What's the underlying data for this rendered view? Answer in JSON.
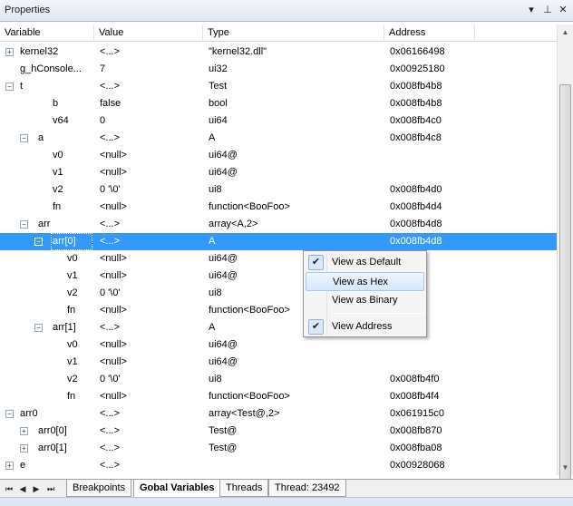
{
  "panel": {
    "title": "Properties",
    "buttons": {
      "dropdown": "▾",
      "pin": "⊥",
      "close": "✕"
    }
  },
  "columns": [
    "Variable",
    "Value",
    "Type",
    "Address"
  ],
  "rows": [
    {
      "name": "kernel32",
      "value": "<...>",
      "type": "\"kernel32.dll\"",
      "address": "0x06166498",
      "level": 0,
      "expander": "+"
    },
    {
      "name": "g_hConsole...",
      "value": "7",
      "type": "ui32",
      "address": "0x00925180",
      "level": 0,
      "expander": ""
    },
    {
      "name": "t",
      "value": "<...>",
      "type": "Test",
      "address": "0x008fb4b8",
      "level": 0,
      "expander": "−"
    },
    {
      "name": "b",
      "value": "false",
      "type": "bool",
      "address": "0x008fb4b8",
      "level": 2,
      "expander": ""
    },
    {
      "name": "v64",
      "value": "0",
      "type": "ui64",
      "address": "0x008fb4c0",
      "level": 2,
      "expander": ""
    },
    {
      "name": "a",
      "value": "<...>",
      "type": "A",
      "address": "0x008fb4c8",
      "level": 1,
      "expander": "−"
    },
    {
      "name": "v0",
      "value": "<null>",
      "type": "ui64@",
      "address": "",
      "level": 3,
      "expander": ""
    },
    {
      "name": "v1",
      "value": "<null>",
      "type": "ui64@",
      "address": "",
      "level": 3,
      "expander": ""
    },
    {
      "name": "v2",
      "value": "0 '\\0'",
      "type": "ui8",
      "address": "0x008fb4d0",
      "level": 3,
      "expander": ""
    },
    {
      "name": "fn",
      "value": "<null>",
      "type": "function<BooFoo>",
      "address": "0x008fb4d4",
      "level": 3,
      "expander": ""
    },
    {
      "name": "arr",
      "value": "<...>",
      "type": "array<A,2>",
      "address": "0x008fb4d8",
      "level": 1,
      "expander": "−"
    },
    {
      "name": "arr[0]",
      "value": "<...>",
      "type": "A",
      "address": "0x008fb4d8",
      "level": 2,
      "expander": "−",
      "selected": true
    },
    {
      "name": "v0",
      "value": "<null>",
      "type": "ui64@",
      "address": "",
      "level": 4,
      "expander": ""
    },
    {
      "name": "v1",
      "value": "<null>",
      "type": "ui64@",
      "address": "",
      "level": 4,
      "expander": ""
    },
    {
      "name": "v2",
      "value": "0 '\\0'",
      "type": "ui8",
      "address": "4e0",
      "level": 4,
      "expander": ""
    },
    {
      "name": "fn",
      "value": "<null>",
      "type": "function<BooFoo>",
      "address": "4e4",
      "level": 4,
      "expander": ""
    },
    {
      "name": "arr[1]",
      "value": "<...>",
      "type": "A",
      "address": "4e8",
      "level": 2,
      "expander": "−"
    },
    {
      "name": "v0",
      "value": "<null>",
      "type": "ui64@",
      "address": "",
      "level": 4,
      "expander": ""
    },
    {
      "name": "v1",
      "value": "<null>",
      "type": "ui64@",
      "address": "",
      "level": 4,
      "expander": ""
    },
    {
      "name": "v2",
      "value": "0 '\\0'",
      "type": "ui8",
      "address": "0x008fb4f0",
      "level": 4,
      "expander": ""
    },
    {
      "name": "fn",
      "value": "<null>",
      "type": "function<BooFoo>",
      "address": "0x008fb4f4",
      "level": 4,
      "expander": ""
    },
    {
      "name": "arr0",
      "value": "<...>",
      "type": "array<Test@,2>",
      "address": "0x061915c0",
      "level": 0,
      "expander": "−"
    },
    {
      "name": "arr0[0]",
      "value": "<...>",
      "type": "Test@",
      "address": "0x008fb870",
      "level": 1,
      "expander": "+"
    },
    {
      "name": "arr0[1]",
      "value": "<...>",
      "type": "Test@",
      "address": "0x008fba08",
      "level": 1,
      "expander": "+"
    },
    {
      "name": "e",
      "value": "<...>",
      "type": "",
      "address": "0x00928068",
      "level": 0,
      "expander": "+"
    }
  ],
  "context_menu": {
    "items": [
      {
        "label": "View as Default",
        "checked": true,
        "hover": false
      },
      {
        "label": "View as Hex",
        "checked": false,
        "hover": true
      },
      {
        "label": "View as Binary",
        "checked": false,
        "hover": false
      },
      {
        "label": "View Address",
        "checked": true,
        "hover": false
      }
    ],
    "check_glyph": "✔"
  },
  "tabs": {
    "nav": [
      "⏮",
      "◀",
      "▶",
      "⏭"
    ],
    "items": [
      {
        "label": "Breakpoints",
        "active": false
      },
      {
        "label": "Gobal Variables",
        "active": true
      },
      {
        "label": "Threads",
        "active": false
      },
      {
        "label": "Thread: 23492",
        "active": false
      }
    ]
  },
  "scrollbar": {
    "up": "▲",
    "down": "▼"
  },
  "colors": {
    "selection": "#3399ff",
    "title_bg": "#dfe7f2"
  }
}
